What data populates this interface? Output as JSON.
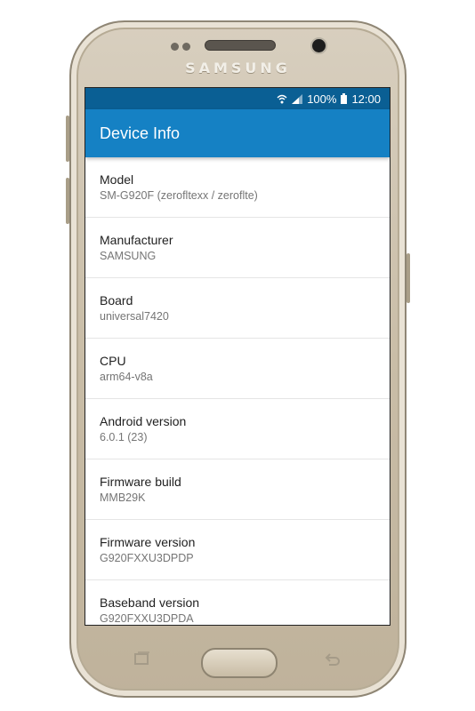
{
  "device": {
    "brand": "SAMSUNG"
  },
  "status_bar": {
    "battery": "100%",
    "time": "12:00"
  },
  "app_bar": {
    "title": "Device Info"
  },
  "items": [
    {
      "title": "Model",
      "value": "SM-G920F (zerofltexx / zeroflte)"
    },
    {
      "title": "Manufacturer",
      "value": "SAMSUNG"
    },
    {
      "title": "Board",
      "value": "universal7420"
    },
    {
      "title": "CPU",
      "value": "arm64-v8a"
    },
    {
      "title": "Android version",
      "value": "6.0.1 (23)"
    },
    {
      "title": "Firmware build",
      "value": "MMB29K"
    },
    {
      "title": "Firmware version",
      "value": "G920FXXU3DPDP"
    },
    {
      "title": "Baseband version",
      "value": "G920FXXU3DPDA"
    }
  ],
  "colors": {
    "status_bar": "#0a5f94",
    "app_bar": "#1581c4",
    "phone_body": "#c9bda7"
  }
}
